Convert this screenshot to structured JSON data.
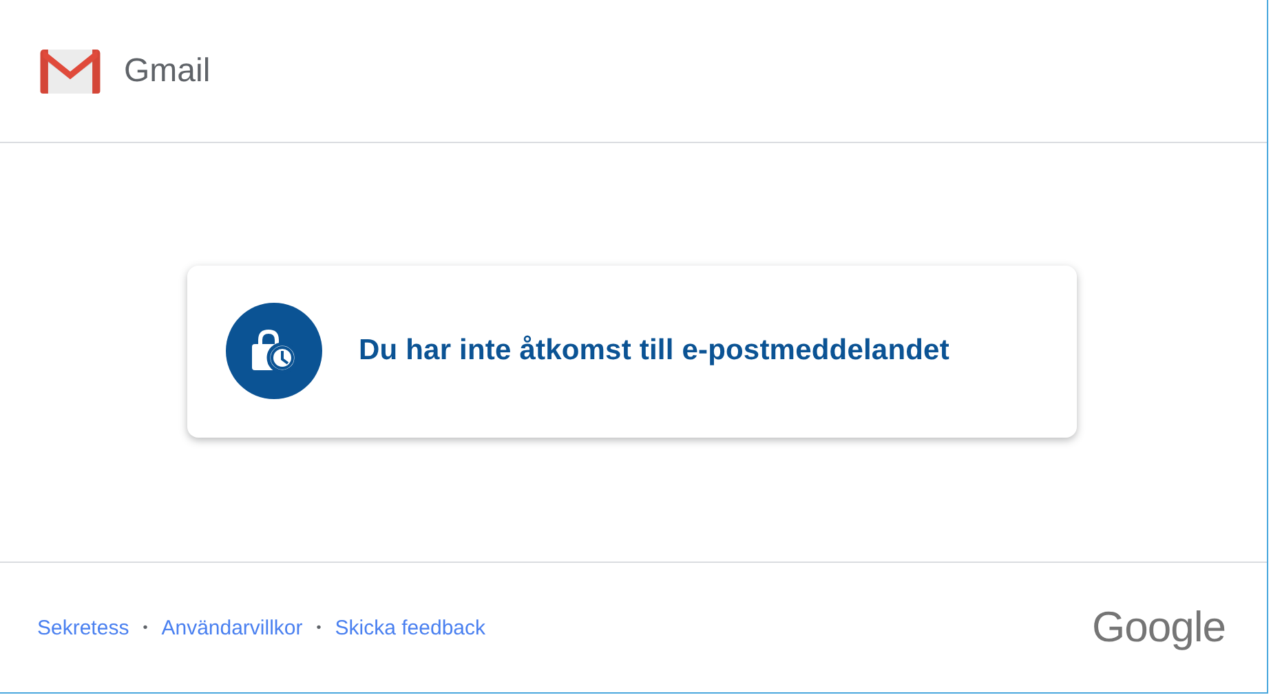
{
  "header": {
    "app_name": "Gmail"
  },
  "message": {
    "text": "Du har inte åtkomst till e-postmeddelandet"
  },
  "footer": {
    "links": [
      {
        "label": "Sekretess"
      },
      {
        "label": "Användarvillkor"
      },
      {
        "label": "Skicka feedback"
      }
    ],
    "separators": [
      "•",
      "•"
    ],
    "brand": "Google"
  }
}
